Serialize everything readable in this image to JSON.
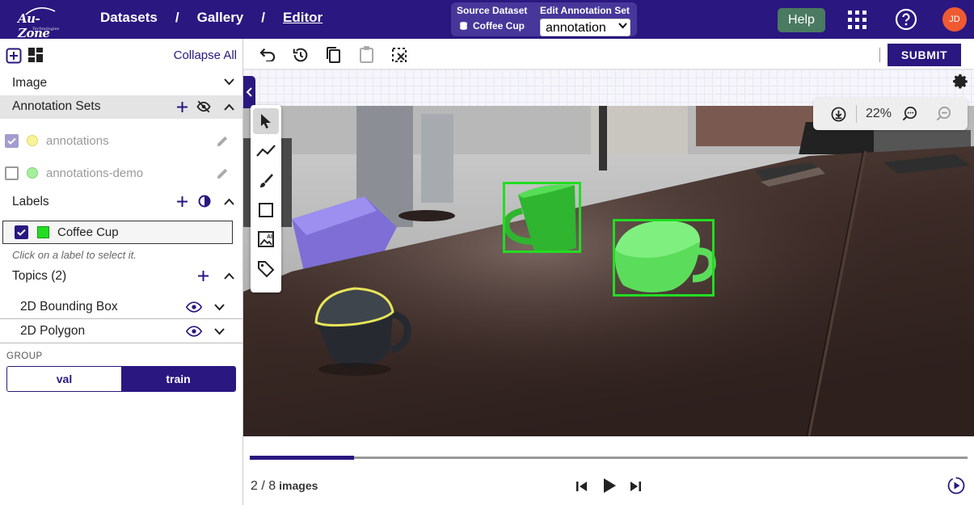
{
  "brand": {
    "logo_text": "Au-Zone",
    "logo_sub": "Technologies"
  },
  "breadcrumb": {
    "items": [
      "Datasets",
      "Gallery",
      "Editor"
    ],
    "separator": "/"
  },
  "dataset_panel": {
    "source_label": "Source Dataset",
    "source_value": "Coffee Cup",
    "edit_label": "Edit Annotation Set",
    "edit_value": "annotation"
  },
  "header": {
    "help_label": "Help",
    "avatar_initials": "JD"
  },
  "sidebar": {
    "collapse_all": "Collapse All",
    "image_section": "Image",
    "annotation_sets_title": "Annotation Sets",
    "annotation_sets": [
      {
        "name": "annotations",
        "checked": true,
        "color": "#f5f08a"
      },
      {
        "name": "annotations-demo",
        "checked": false,
        "color": "#9be89b"
      }
    ],
    "labels_title": "Labels",
    "labels": [
      {
        "name": "Coffee Cup",
        "color": "#22dd22",
        "checked": true
      }
    ],
    "labels_hint": "Click on a label to select it.",
    "topics_title": "Topics (2)",
    "topics": [
      {
        "name": "2D Bounding Box"
      },
      {
        "name": "2D Polygon"
      }
    ],
    "group_label": "GROUP",
    "group_options": [
      "val",
      "train"
    ],
    "group_selected": "train"
  },
  "toolbar": {
    "submit_label": "SUBMIT"
  },
  "viewer": {
    "zoom": "22%"
  },
  "player": {
    "current": 2,
    "total": 8,
    "counter_text": "2 / 8",
    "unit": "images",
    "progress": 0.145
  },
  "colors": {
    "brand": "#2a1780",
    "help": "#4a7a60",
    "avatar": "#ef5a32",
    "bbox": "#22dd22"
  },
  "icons": [
    "add-box-icon",
    "dashboard-icon",
    "chevron-down-icon",
    "plus-icon",
    "eye-off-icon",
    "chevron-up-icon",
    "pencil-icon",
    "contrast-icon",
    "eye-icon",
    "undo-icon",
    "history-icon",
    "copy-icon",
    "paste-icon",
    "deselect-icon",
    "gear-icon",
    "select-arrow-icon",
    "polyline-icon",
    "brush-icon",
    "rectangle-icon",
    "ai-image-icon",
    "tag-icon",
    "download-icon",
    "zoom-in-icon",
    "zoom-out-icon",
    "skip-previous-icon",
    "play-icon",
    "skip-next-icon",
    "autoplay-icon",
    "apps-icon",
    "help-circle-icon",
    "database-icon"
  ]
}
